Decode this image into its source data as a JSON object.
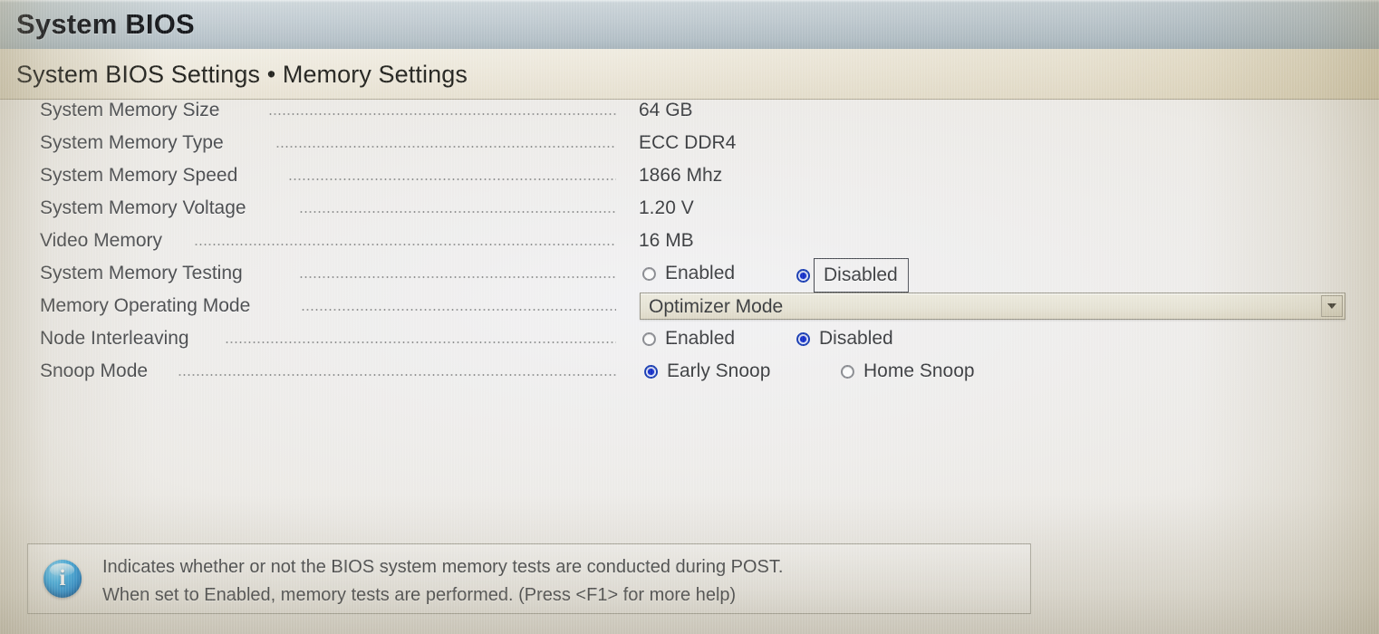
{
  "header": {
    "title": "System BIOS",
    "breadcrumb": "System BIOS Settings • Memory Settings"
  },
  "settings": [
    {
      "label": "System Memory Size",
      "type": "value",
      "value": "64 GB"
    },
    {
      "label": "System Memory Type",
      "type": "value",
      "value": "ECC DDR4"
    },
    {
      "label": "System Memory Speed",
      "type": "value",
      "value": "1866 Mhz"
    },
    {
      "label": "System Memory Voltage",
      "type": "value",
      "value": "1.20 V"
    },
    {
      "label": "Video Memory",
      "type": "value",
      "value": "16 MB"
    },
    {
      "label": "System Memory Testing",
      "type": "radio",
      "options": [
        "Enabled",
        "Disabled"
      ],
      "selected": "Disabled",
      "focused": "Disabled"
    },
    {
      "label": "Memory Operating Mode",
      "type": "select",
      "value": "Optimizer Mode"
    },
    {
      "label": "Node Interleaving",
      "type": "radio",
      "options": [
        "Enabled",
        "Disabled"
      ],
      "selected": "Disabled"
    },
    {
      "label": "Snoop Mode",
      "type": "radio",
      "options": [
        "Early Snoop",
        "Home Snoop"
      ],
      "selected": "Early Snoop"
    }
  ],
  "help": {
    "icon": "info-icon",
    "line1": "Indicates whether or not the BIOS system memory tests are conducted during POST.",
    "line2": "When set to Enabled, memory tests are performed. (Press <F1> for more help)"
  },
  "colors": {
    "header_band": "#b9c4ca",
    "subheader_band": "#ece7da",
    "radio_selected": "#1630c8",
    "info_icon": "#1c86d0",
    "text": "#3d3f42"
  }
}
